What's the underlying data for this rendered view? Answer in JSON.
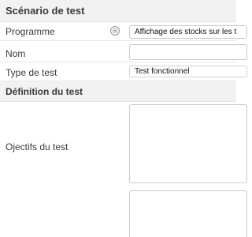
{
  "section_test_scenario": {
    "title": "Scénario de test"
  },
  "fields": {
    "programme": {
      "label": "Programme",
      "value": "Affichage des stocks sur les t"
    },
    "nom": {
      "label": "Nom",
      "value": ""
    },
    "type_de_test": {
      "label": "Type de test",
      "value": "Test fonctionnel"
    }
  },
  "section_definition": {
    "title": "Définition du test"
  },
  "definition_fields": {
    "objectifs": {
      "label": "Ojectifs du test",
      "value": ""
    },
    "next_textarea": {
      "value": ""
    }
  },
  "colors": {
    "section_background": "#f2f2f2",
    "border": "#c8c8c8",
    "text": "#333333"
  }
}
